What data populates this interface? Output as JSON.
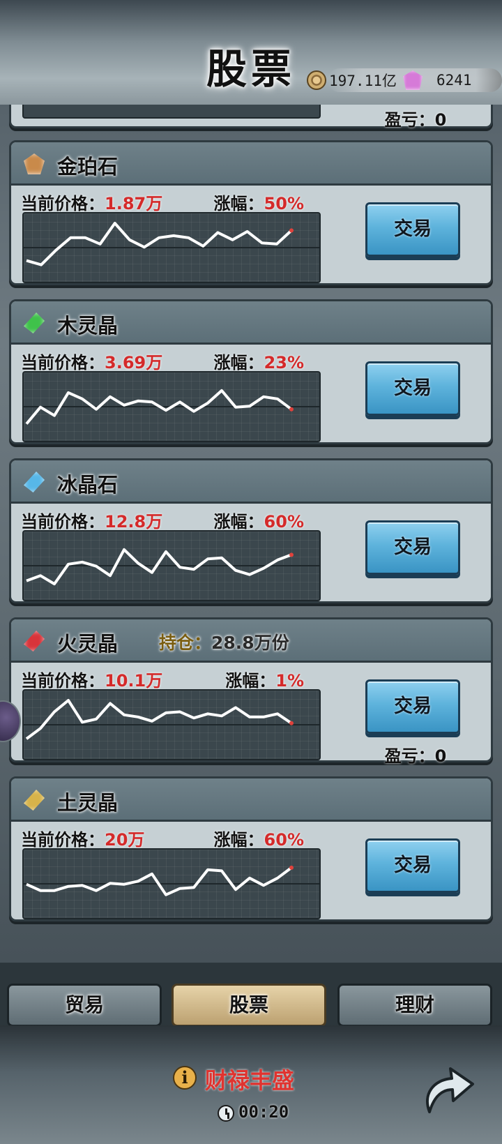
{
  "header": {
    "title": "股票",
    "coins": "197.11亿",
    "gems": "6241"
  },
  "top_partial_card": {
    "pnl_label": "盈亏：",
    "pnl_value": "0"
  },
  "labels": {
    "price": "当前价格：",
    "rise": "涨幅：",
    "trade": "交易",
    "pnl": "盈亏：",
    "holding": "持仓："
  },
  "stocks": [
    {
      "name": "金珀石",
      "icon": "amber-stone-icon",
      "icon_color": "#c98a4a",
      "price": "1.87万",
      "rise": "50%",
      "series": [
        3.0,
        2.6,
        4.0,
        5.2,
        5.2,
        4.6,
        6.6,
        5.0,
        4.3,
        5.2,
        5.4,
        5.2,
        4.4,
        5.7,
        5.0,
        5.8,
        4.7,
        4.6,
        5.9
      ]
    },
    {
      "name": "木灵晶",
      "icon": "green-crystal-icon",
      "icon_color": "#3fc24a",
      "price": "3.69万",
      "rise": "23%",
      "series": [
        2.6,
        4.2,
        3.4,
        5.6,
        5.0,
        4.0,
        5.2,
        4.4,
        4.8,
        4.7,
        3.9,
        4.7,
        3.8,
        4.6,
        5.8,
        4.2,
        4.3,
        5.2,
        5.0,
        4.0
      ]
    },
    {
      "name": "冰晶石",
      "icon": "ice-crystal-icon",
      "icon_color": "#57b7e8",
      "price": "12.8万",
      "rise": "60%",
      "series": [
        2.8,
        3.3,
        2.5,
        4.4,
        4.6,
        4.2,
        3.3,
        5.8,
        4.5,
        3.6,
        5.6,
        4.1,
        3.9,
        4.9,
        5.0,
        3.8,
        3.4,
        4.0,
        4.8,
        5.3
      ]
    },
    {
      "name": "火灵晶",
      "icon": "fire-crystal-icon",
      "icon_color": "#d8343a",
      "price": "10.1万",
      "rise": "1%",
      "holding": "28.8万份",
      "pnl": "0",
      "series": [
        2.9,
        3.9,
        5.5,
        6.6,
        4.5,
        4.8,
        6.3,
        5.2,
        5.0,
        4.6,
        5.4,
        5.5,
        4.9,
        5.3,
        5.1,
        5.9,
        5.0,
        5.0,
        5.3,
        4.4
      ]
    },
    {
      "name": "土灵晶",
      "icon": "earth-crystal-icon",
      "icon_color": "#d7b34a",
      "price": "20万",
      "rise": "60%",
      "series": [
        4.2,
        3.6,
        3.6,
        4.0,
        4.1,
        3.6,
        4.3,
        4.2,
        4.5,
        5.2,
        3.2,
        3.8,
        3.9,
        5.6,
        5.5,
        3.7,
        4.8,
        4.1,
        4.8,
        5.8
      ]
    }
  ],
  "tabs": [
    {
      "label": "贸易"
    },
    {
      "label": "股票"
    },
    {
      "label": "理财"
    }
  ],
  "footer": {
    "status": "财禄丰盛",
    "timer": "00:20"
  }
}
